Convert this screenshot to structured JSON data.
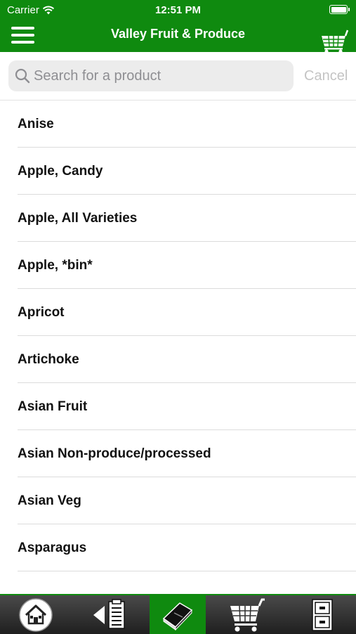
{
  "status_bar": {
    "carrier": "Carrier",
    "time": "12:51 PM"
  },
  "nav": {
    "title": "Valley Fruit & Produce",
    "menu_icon": "hamburger-menu-icon",
    "cart_icon": "shopping-cart-icon"
  },
  "search": {
    "placeholder": "Search for a product",
    "value": "",
    "cancel_label": "Cancel"
  },
  "products": [
    "Anise",
    "Apple, Candy",
    "Apple, All Varieties",
    "Apple, *bin*",
    "Apricot",
    "Artichoke",
    "Asian Fruit",
    "Asian Non-produce/processed",
    "Asian Veg",
    "Asparagus"
  ],
  "tabs": [
    {
      "name": "home",
      "icon": "home-icon",
      "active": false
    },
    {
      "name": "orders",
      "icon": "clipboard-back-icon",
      "active": false
    },
    {
      "name": "catalog",
      "icon": "book-icon",
      "active": true
    },
    {
      "name": "cart",
      "icon": "cart-icon",
      "active": false
    },
    {
      "name": "files",
      "icon": "file-cabinet-icon",
      "active": false
    }
  ],
  "colors": {
    "brand_green": "#0f8a0f",
    "tabbar_dark": "#2b2b2b",
    "cancel_gray": "#c4c4c4"
  }
}
